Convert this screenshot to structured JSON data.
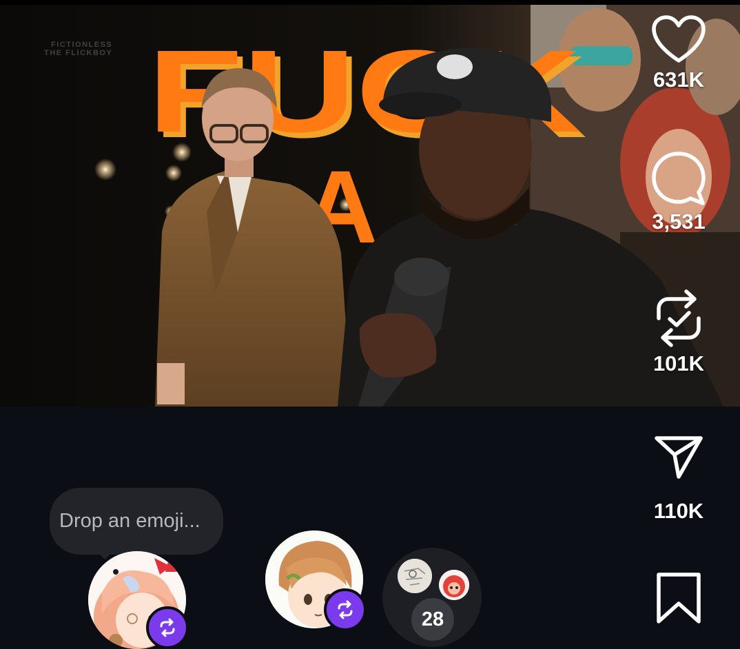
{
  "video": {
    "watermark_line1": "FICTIONLESS",
    "watermark_line2": "THE FLICKBOY",
    "overlay_text": "FUCK"
  },
  "actions": {
    "likes": "631K",
    "comments": "3,531",
    "reposts": "101K",
    "shares": "110K"
  },
  "reply": {
    "placeholder": "Drop an emoji..."
  },
  "group_avatar": {
    "count": "28"
  },
  "colors": {
    "background": "#0b0e14",
    "accent_purple": "#7c3aed",
    "overlay_orange": "#ff7a12"
  },
  "icons": [
    "heart-icon",
    "comment-icon",
    "repost-icon",
    "share-icon",
    "bookmark-icon",
    "repost-badge-icon"
  ]
}
